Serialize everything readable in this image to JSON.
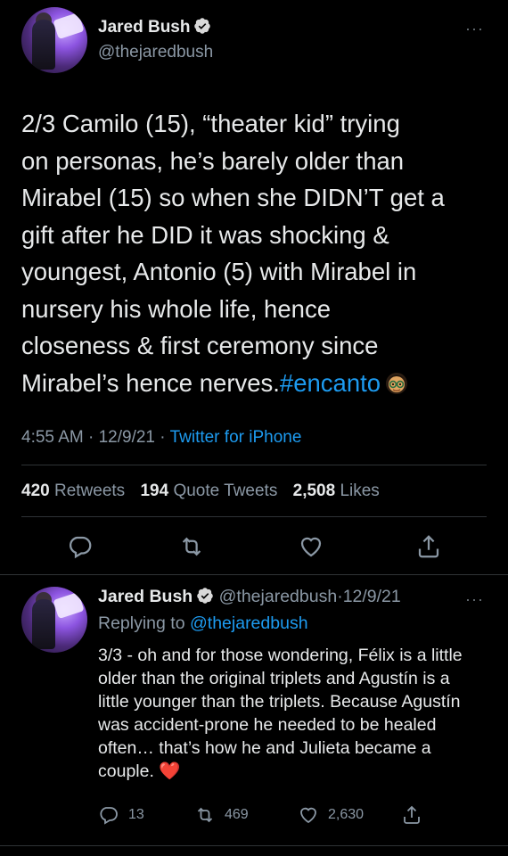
{
  "main_tweet": {
    "author_name": "Jared Bush",
    "handle": "@thejaredbush",
    "text_lines": [
      "2/3 Camilo (15), “theater kid” trying",
      "on personas, he’s barely older than",
      "Mirabel (15) so when she DIDN’T get a",
      "gift after he DID it was shocking &",
      "youngest, Antonio (5) with Mirabel in",
      "nursery his whole life, hence",
      "closeness & first ceremony since"
    ],
    "last_line_text": "Mirabel’s hence nerves.",
    "hashtag": "#encanto",
    "time": "4:55 AM",
    "date": "12/9/21",
    "separator": "·",
    "source": "Twitter for iPhone",
    "retweets_count": "420",
    "retweets_label": "Retweets",
    "quotes_count": "194",
    "quotes_label": "Quote Tweets",
    "likes_count": "2,508",
    "likes_label": "Likes"
  },
  "reply_tweet": {
    "author_name": "Jared Bush",
    "handle": "@thejaredbush",
    "separator": "·",
    "date": "12/9/21",
    "replying_label": "Replying to",
    "replying_to": "@thejaredbush",
    "text": "3/3 - oh and for those wondering, Félix is a little older than the original triplets and Agustín is a little younger than the triplets. Because Agustín was accident-prone he needed to be healed often… that’s how he and Julieta became a couple.",
    "emoji": "❤️",
    "replies": "13",
    "retweets": "469",
    "likes": "2,630"
  },
  "icons": {
    "more": "more-icon",
    "reply": "reply-icon",
    "retweet": "retweet-icon",
    "like": "like-icon",
    "share": "share-icon",
    "verified": "verified-icon"
  },
  "colors": {
    "background": "#000000",
    "text": "#e7e9ea",
    "secondary": "#8b98a5",
    "link": "#1d9bf0",
    "divider": "#2f3336"
  }
}
